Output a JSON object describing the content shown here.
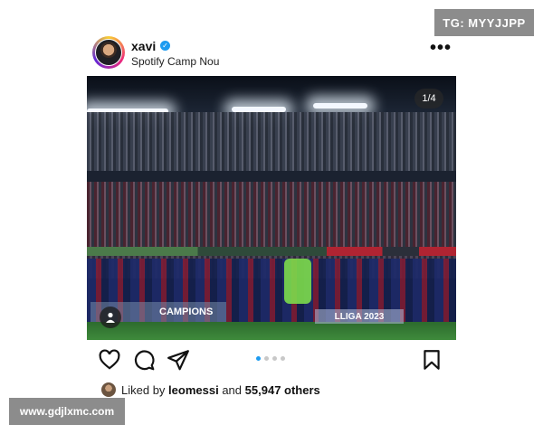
{
  "watermark": {
    "top": "TG: MYYJJPP",
    "bottom": "www.gdjlxmc.com"
  },
  "post": {
    "username": "xavi",
    "verified": true,
    "location": "Spotify Camp Nou",
    "more_label": "•••"
  },
  "photo": {
    "page_counter": "1/4",
    "banner_left": "CAMPIONS",
    "banner_right": "LLIGA 2023",
    "current_page": 1,
    "total_pages": 4
  },
  "carousel": {
    "dot_count": 4,
    "active_dot": 1
  },
  "likes": {
    "prefix": "Liked by",
    "user": "leomessi",
    "connector": "and",
    "count": "55,947 others"
  },
  "colors": {
    "verified": "#1d9bf0",
    "carousel_active": "#1d9bf0"
  },
  "icons": [
    "heart-icon",
    "comment-icon",
    "share-icon",
    "bookmark-icon",
    "more-icon",
    "tag-user-icon"
  ]
}
